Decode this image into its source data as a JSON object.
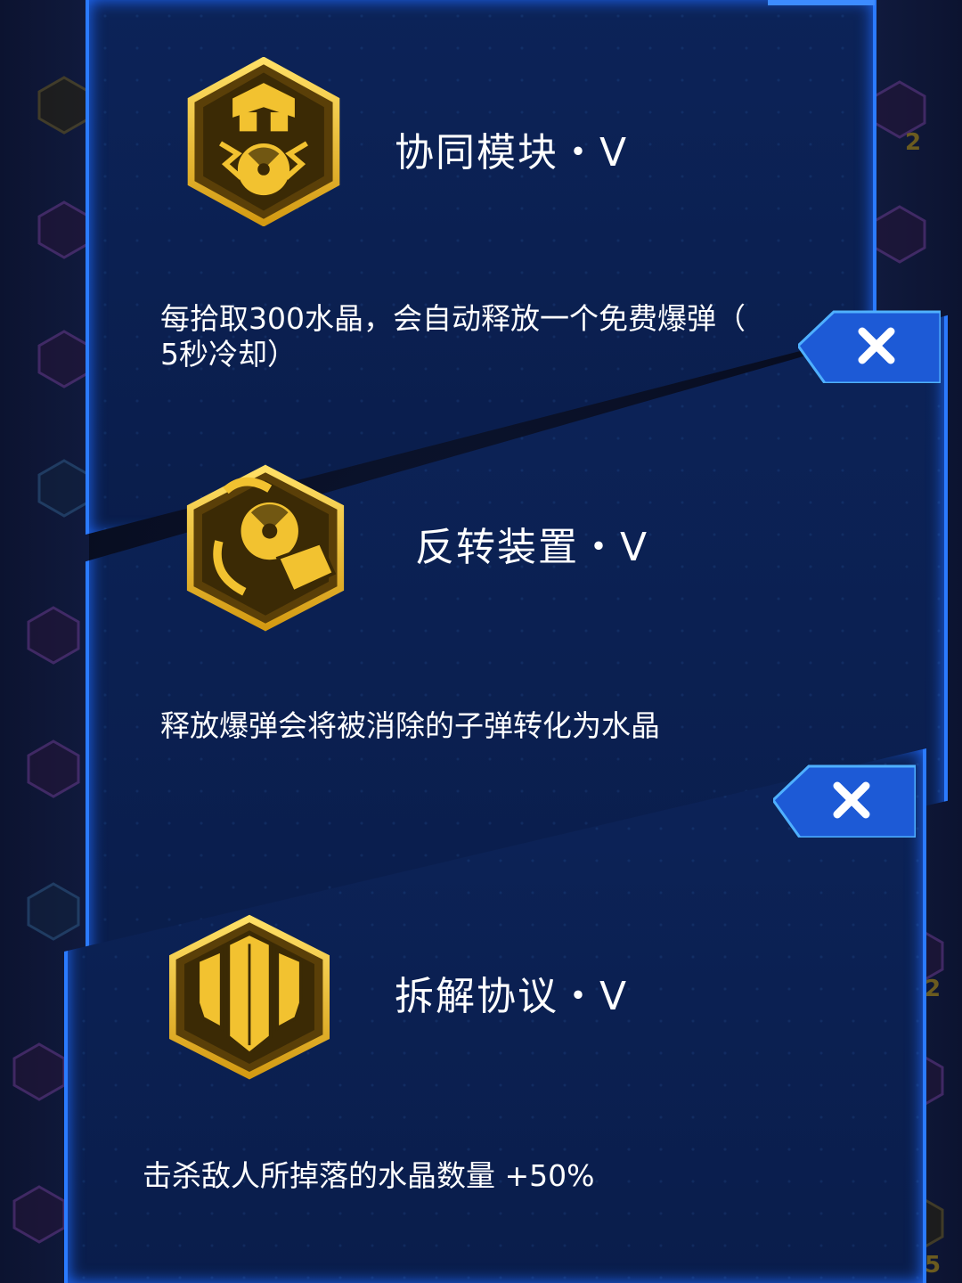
{
  "colors": {
    "panel_fill": "#0b1f50",
    "panel_border": "#2b7bff",
    "badge_gold": "#f2c230",
    "badge_dark": "#3b2a05",
    "close_tab": "#1d5ad6",
    "text": "#ffffff"
  },
  "cards": [
    {
      "icon": "nuclear-module-icon",
      "title": "协同模块・V",
      "description_line1": "每拾取300水晶，会自动释放一个免费爆弹（",
      "description_line2": "5秒冷却）"
    },
    {
      "icon": "reversal-device-icon",
      "title": "反转装置・V",
      "description_line1": "释放爆弹会将被消除的子弹转化为水晶",
      "description_line2": ""
    },
    {
      "icon": "crystal-cluster-icon",
      "title": "拆解协议・V",
      "description_line1": "击杀敌人所掉落的水晶数量 +50%",
      "description_line2": ""
    }
  ],
  "close_label": "✕",
  "side_numbers": [
    "2",
    "2",
    "5"
  ]
}
